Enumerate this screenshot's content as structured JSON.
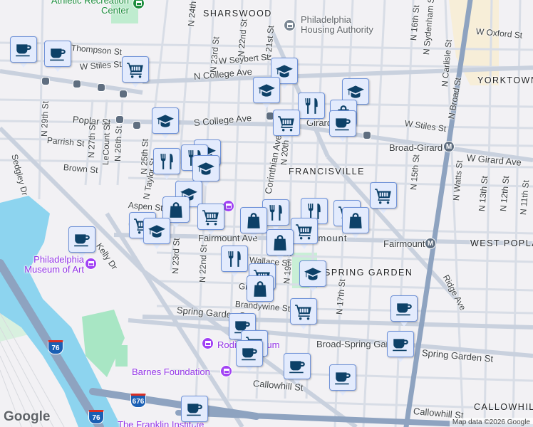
{
  "map": {
    "areas": [
      "SHARSWOOD",
      "YORKTOWN",
      "FRANCISVILLE",
      "SPRING GARDEN",
      "WEST POPLAR",
      "CALLOWHILL"
    ],
    "pois": [
      "Athletic Recreation Center",
      "Philadelphia Housing Authority",
      "Philadelphia Museum of Art",
      "Barnes Foundation",
      "The Franklin Institute",
      "Rodin Museum"
    ],
    "streets": [
      "Thompson St",
      "W Stiles St",
      "N College Ave",
      "Poplar St",
      "S College Ave",
      "Parrish St",
      "Brown St",
      "N 29th St",
      "N 27th St",
      "LeCount St",
      "N 26th St",
      "N 25th St",
      "N Taylor St",
      "Sedgley Dr",
      "Aspen St",
      "Fairmount Ave",
      "Kelly Dr",
      "N 23rd St",
      "N 22nd St",
      "Spring Garden St",
      "Callowhill St",
      "Broad-Spring Garden",
      "Broad-Girard",
      "W Girard Ave",
      "N Broad St",
      "N 16th St",
      "N Sydenham St",
      "N Carlisle St",
      "W Oxford St",
      "N 15th St",
      "N Watts St",
      "N 13th St",
      "N 12th St",
      "N 11th St",
      "N 17th St",
      "N 19th St",
      "N 20th St",
      "N 21st St",
      "N 22nd St",
      "N 23rd St",
      "N 24th St",
      "W Seybert St",
      "Corinthian Ave",
      "Ridge Ave",
      "Fairmount",
      "Wallace St",
      "Green St",
      "Brandywine St",
      "Spring Garden St",
      "Callowhill St",
      "W Stiles St",
      "Fairmount",
      "Girard"
    ],
    "shields": [
      "76",
      "676",
      "76"
    ],
    "metro_letter": "M",
    "attribution": "Map data ©2026 Google",
    "logo": "Google"
  },
  "marker_types": {
    "coffee": "coffee-shop",
    "cart": "grocery-store",
    "cap": "school",
    "fork": "restaurant",
    "bag": "shopping"
  },
  "colors": {
    "marker_bg": "#e3ebfd",
    "marker_border": "#6f92d8",
    "icon": "#0d4168",
    "water": "#8dd4ef",
    "highway": "#8ea3c0",
    "park": "#a8e6c4"
  }
}
